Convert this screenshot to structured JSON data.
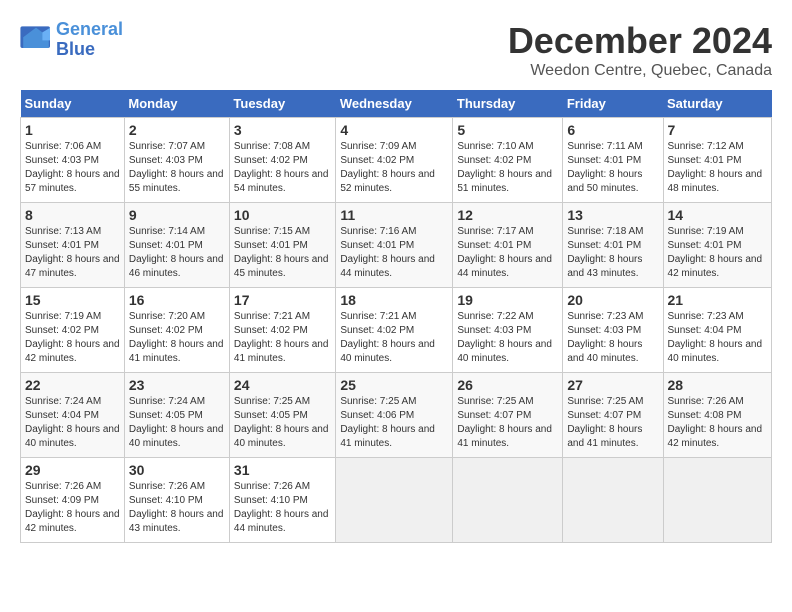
{
  "logo": {
    "line1": "General",
    "line2": "Blue"
  },
  "title": "December 2024",
  "location": "Weedon Centre, Quebec, Canada",
  "days_of_week": [
    "Sunday",
    "Monday",
    "Tuesday",
    "Wednesday",
    "Thursday",
    "Friday",
    "Saturday"
  ],
  "weeks": [
    [
      {
        "day": "1",
        "sunrise": "7:06 AM",
        "sunset": "4:03 PM",
        "daylight": "8 hours and 57 minutes."
      },
      {
        "day": "2",
        "sunrise": "7:07 AM",
        "sunset": "4:03 PM",
        "daylight": "8 hours and 55 minutes."
      },
      {
        "day": "3",
        "sunrise": "7:08 AM",
        "sunset": "4:02 PM",
        "daylight": "8 hours and 54 minutes."
      },
      {
        "day": "4",
        "sunrise": "7:09 AM",
        "sunset": "4:02 PM",
        "daylight": "8 hours and 52 minutes."
      },
      {
        "day": "5",
        "sunrise": "7:10 AM",
        "sunset": "4:02 PM",
        "daylight": "8 hours and 51 minutes."
      },
      {
        "day": "6",
        "sunrise": "7:11 AM",
        "sunset": "4:01 PM",
        "daylight": "8 hours and 50 minutes."
      },
      {
        "day": "7",
        "sunrise": "7:12 AM",
        "sunset": "4:01 PM",
        "daylight": "8 hours and 48 minutes."
      }
    ],
    [
      {
        "day": "8",
        "sunrise": "7:13 AM",
        "sunset": "4:01 PM",
        "daylight": "8 hours and 47 minutes."
      },
      {
        "day": "9",
        "sunrise": "7:14 AM",
        "sunset": "4:01 PM",
        "daylight": "8 hours and 46 minutes."
      },
      {
        "day": "10",
        "sunrise": "7:15 AM",
        "sunset": "4:01 PM",
        "daylight": "8 hours and 45 minutes."
      },
      {
        "day": "11",
        "sunrise": "7:16 AM",
        "sunset": "4:01 PM",
        "daylight": "8 hours and 44 minutes."
      },
      {
        "day": "12",
        "sunrise": "7:17 AM",
        "sunset": "4:01 PM",
        "daylight": "8 hours and 44 minutes."
      },
      {
        "day": "13",
        "sunrise": "7:18 AM",
        "sunset": "4:01 PM",
        "daylight": "8 hours and 43 minutes."
      },
      {
        "day": "14",
        "sunrise": "7:19 AM",
        "sunset": "4:01 PM",
        "daylight": "8 hours and 42 minutes."
      }
    ],
    [
      {
        "day": "15",
        "sunrise": "7:19 AM",
        "sunset": "4:02 PM",
        "daylight": "8 hours and 42 minutes."
      },
      {
        "day": "16",
        "sunrise": "7:20 AM",
        "sunset": "4:02 PM",
        "daylight": "8 hours and 41 minutes."
      },
      {
        "day": "17",
        "sunrise": "7:21 AM",
        "sunset": "4:02 PM",
        "daylight": "8 hours and 41 minutes."
      },
      {
        "day": "18",
        "sunrise": "7:21 AM",
        "sunset": "4:02 PM",
        "daylight": "8 hours and 40 minutes."
      },
      {
        "day": "19",
        "sunrise": "7:22 AM",
        "sunset": "4:03 PM",
        "daylight": "8 hours and 40 minutes."
      },
      {
        "day": "20",
        "sunrise": "7:23 AM",
        "sunset": "4:03 PM",
        "daylight": "8 hours and 40 minutes."
      },
      {
        "day": "21",
        "sunrise": "7:23 AM",
        "sunset": "4:04 PM",
        "daylight": "8 hours and 40 minutes."
      }
    ],
    [
      {
        "day": "22",
        "sunrise": "7:24 AM",
        "sunset": "4:04 PM",
        "daylight": "8 hours and 40 minutes."
      },
      {
        "day": "23",
        "sunrise": "7:24 AM",
        "sunset": "4:05 PM",
        "daylight": "8 hours and 40 minutes."
      },
      {
        "day": "24",
        "sunrise": "7:25 AM",
        "sunset": "4:05 PM",
        "daylight": "8 hours and 40 minutes."
      },
      {
        "day": "25",
        "sunrise": "7:25 AM",
        "sunset": "4:06 PM",
        "daylight": "8 hours and 41 minutes."
      },
      {
        "day": "26",
        "sunrise": "7:25 AM",
        "sunset": "4:07 PM",
        "daylight": "8 hours and 41 minutes."
      },
      {
        "day": "27",
        "sunrise": "7:25 AM",
        "sunset": "4:07 PM",
        "daylight": "8 hours and 41 minutes."
      },
      {
        "day": "28",
        "sunrise": "7:26 AM",
        "sunset": "4:08 PM",
        "daylight": "8 hours and 42 minutes."
      }
    ],
    [
      {
        "day": "29",
        "sunrise": "7:26 AM",
        "sunset": "4:09 PM",
        "daylight": "8 hours and 42 minutes."
      },
      {
        "day": "30",
        "sunrise": "7:26 AM",
        "sunset": "4:10 PM",
        "daylight": "8 hours and 43 minutes."
      },
      {
        "day": "31",
        "sunrise": "7:26 AM",
        "sunset": "4:10 PM",
        "daylight": "8 hours and 44 minutes."
      },
      null,
      null,
      null,
      null
    ]
  ]
}
